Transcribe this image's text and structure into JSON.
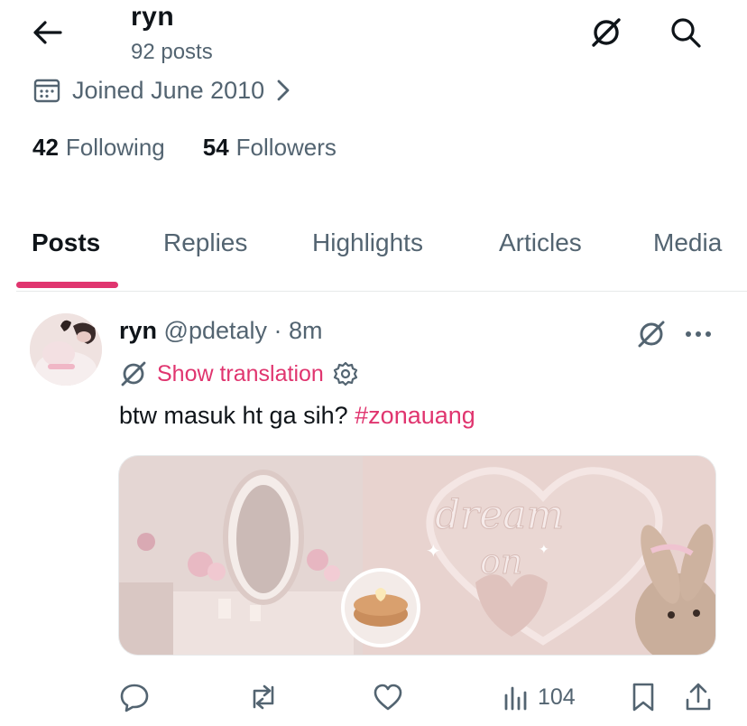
{
  "header": {
    "name": "ryn",
    "posts_count": "92 posts"
  },
  "profile": {
    "joined": "Joined June 2010",
    "following_count": "42",
    "following_label": "Following",
    "followers_count": "54",
    "followers_label": "Followers"
  },
  "tabs": [
    {
      "label": "Posts",
      "active": true
    },
    {
      "label": "Replies",
      "active": false
    },
    {
      "label": "Highlights",
      "active": false
    },
    {
      "label": "Articles",
      "active": false
    },
    {
      "label": "Media",
      "active": false
    }
  ],
  "post": {
    "name": "ryn",
    "handle": "@pdetaly",
    "time": "· 8m",
    "show_translation": "Show translation",
    "text": "btw masuk ht ga sih?",
    "hashtag": "#zonauang",
    "media_overlay": "dream on",
    "media_sticker": "✦ Ƹ̵̡Ӝ̵̨̄Ʒ ⋆",
    "views": "104"
  },
  "icons": {
    "back": "arrow-left-icon",
    "translate": "translate-slash-icon",
    "search": "search-icon",
    "calendar": "calendar-icon",
    "chevron": "chevron-right-icon",
    "more": "more-dots-icon",
    "gear": "gear-icon",
    "reply": "reply-icon",
    "repost": "repost-icon",
    "like": "heart-icon",
    "views": "views-chart-icon",
    "bookmark": "bookmark-icon",
    "share": "share-icon"
  },
  "colors": {
    "accent": "#e0356f",
    "text_primary": "#0f1419",
    "text_secondary": "#536471"
  }
}
